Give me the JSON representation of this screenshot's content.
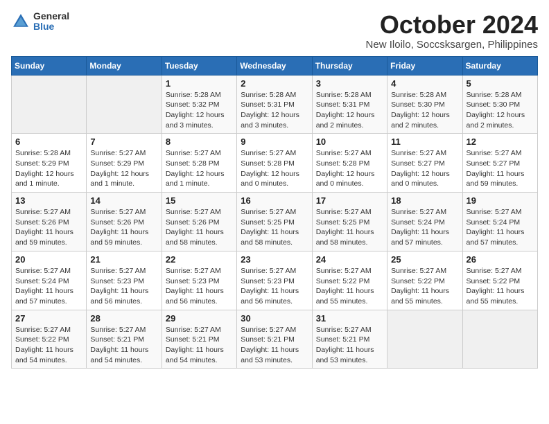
{
  "logo": {
    "general": "General",
    "blue": "Blue"
  },
  "title": "October 2024",
  "location": "New Iloilo, Soccsksargen, Philippines",
  "days_header": [
    "Sunday",
    "Monday",
    "Tuesday",
    "Wednesday",
    "Thursday",
    "Friday",
    "Saturday"
  ],
  "weeks": [
    [
      {
        "day": "",
        "info": ""
      },
      {
        "day": "",
        "info": ""
      },
      {
        "day": "1",
        "info": "Sunrise: 5:28 AM\nSunset: 5:32 PM\nDaylight: 12 hours and 3 minutes."
      },
      {
        "day": "2",
        "info": "Sunrise: 5:28 AM\nSunset: 5:31 PM\nDaylight: 12 hours and 3 minutes."
      },
      {
        "day": "3",
        "info": "Sunrise: 5:28 AM\nSunset: 5:31 PM\nDaylight: 12 hours and 2 minutes."
      },
      {
        "day": "4",
        "info": "Sunrise: 5:28 AM\nSunset: 5:30 PM\nDaylight: 12 hours and 2 minutes."
      },
      {
        "day": "5",
        "info": "Sunrise: 5:28 AM\nSunset: 5:30 PM\nDaylight: 12 hours and 2 minutes."
      }
    ],
    [
      {
        "day": "6",
        "info": "Sunrise: 5:28 AM\nSunset: 5:29 PM\nDaylight: 12 hours and 1 minute."
      },
      {
        "day": "7",
        "info": "Sunrise: 5:27 AM\nSunset: 5:29 PM\nDaylight: 12 hours and 1 minute."
      },
      {
        "day": "8",
        "info": "Sunrise: 5:27 AM\nSunset: 5:28 PM\nDaylight: 12 hours and 1 minute."
      },
      {
        "day": "9",
        "info": "Sunrise: 5:27 AM\nSunset: 5:28 PM\nDaylight: 12 hours and 0 minutes."
      },
      {
        "day": "10",
        "info": "Sunrise: 5:27 AM\nSunset: 5:28 PM\nDaylight: 12 hours and 0 minutes."
      },
      {
        "day": "11",
        "info": "Sunrise: 5:27 AM\nSunset: 5:27 PM\nDaylight: 12 hours and 0 minutes."
      },
      {
        "day": "12",
        "info": "Sunrise: 5:27 AM\nSunset: 5:27 PM\nDaylight: 11 hours and 59 minutes."
      }
    ],
    [
      {
        "day": "13",
        "info": "Sunrise: 5:27 AM\nSunset: 5:26 PM\nDaylight: 11 hours and 59 minutes."
      },
      {
        "day": "14",
        "info": "Sunrise: 5:27 AM\nSunset: 5:26 PM\nDaylight: 11 hours and 59 minutes."
      },
      {
        "day": "15",
        "info": "Sunrise: 5:27 AM\nSunset: 5:26 PM\nDaylight: 11 hours and 58 minutes."
      },
      {
        "day": "16",
        "info": "Sunrise: 5:27 AM\nSunset: 5:25 PM\nDaylight: 11 hours and 58 minutes."
      },
      {
        "day": "17",
        "info": "Sunrise: 5:27 AM\nSunset: 5:25 PM\nDaylight: 11 hours and 58 minutes."
      },
      {
        "day": "18",
        "info": "Sunrise: 5:27 AM\nSunset: 5:24 PM\nDaylight: 11 hours and 57 minutes."
      },
      {
        "day": "19",
        "info": "Sunrise: 5:27 AM\nSunset: 5:24 PM\nDaylight: 11 hours and 57 minutes."
      }
    ],
    [
      {
        "day": "20",
        "info": "Sunrise: 5:27 AM\nSunset: 5:24 PM\nDaylight: 11 hours and 57 minutes."
      },
      {
        "day": "21",
        "info": "Sunrise: 5:27 AM\nSunset: 5:23 PM\nDaylight: 11 hours and 56 minutes."
      },
      {
        "day": "22",
        "info": "Sunrise: 5:27 AM\nSunset: 5:23 PM\nDaylight: 11 hours and 56 minutes."
      },
      {
        "day": "23",
        "info": "Sunrise: 5:27 AM\nSunset: 5:23 PM\nDaylight: 11 hours and 56 minutes."
      },
      {
        "day": "24",
        "info": "Sunrise: 5:27 AM\nSunset: 5:22 PM\nDaylight: 11 hours and 55 minutes."
      },
      {
        "day": "25",
        "info": "Sunrise: 5:27 AM\nSunset: 5:22 PM\nDaylight: 11 hours and 55 minutes."
      },
      {
        "day": "26",
        "info": "Sunrise: 5:27 AM\nSunset: 5:22 PM\nDaylight: 11 hours and 55 minutes."
      }
    ],
    [
      {
        "day": "27",
        "info": "Sunrise: 5:27 AM\nSunset: 5:22 PM\nDaylight: 11 hours and 54 minutes."
      },
      {
        "day": "28",
        "info": "Sunrise: 5:27 AM\nSunset: 5:21 PM\nDaylight: 11 hours and 54 minutes."
      },
      {
        "day": "29",
        "info": "Sunrise: 5:27 AM\nSunset: 5:21 PM\nDaylight: 11 hours and 54 minutes."
      },
      {
        "day": "30",
        "info": "Sunrise: 5:27 AM\nSunset: 5:21 PM\nDaylight: 11 hours and 53 minutes."
      },
      {
        "day": "31",
        "info": "Sunrise: 5:27 AM\nSunset: 5:21 PM\nDaylight: 11 hours and 53 minutes."
      },
      {
        "day": "",
        "info": ""
      },
      {
        "day": "",
        "info": ""
      }
    ]
  ]
}
